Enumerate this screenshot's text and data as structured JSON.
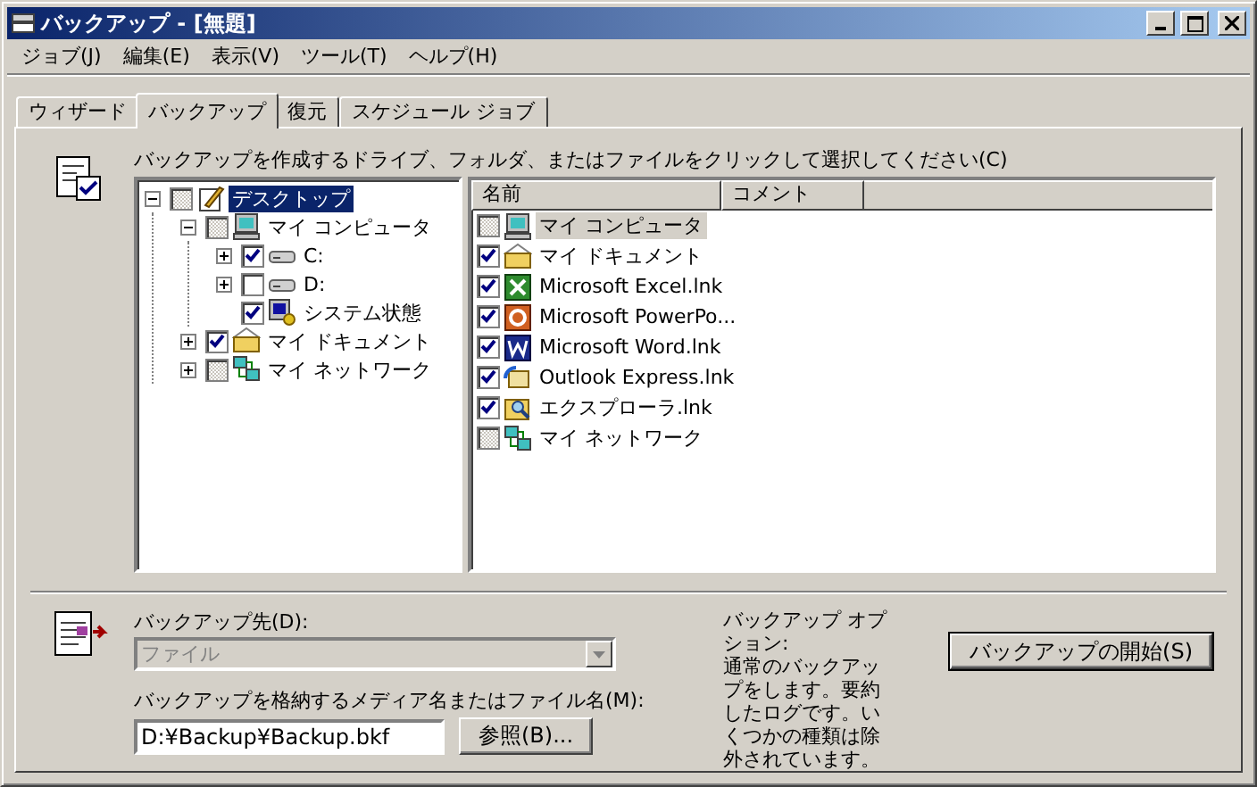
{
  "window": {
    "title": "バックアップ - [無題]"
  },
  "menu": [
    "ジョブ(J)",
    "編集(E)",
    "表示(V)",
    "ツール(T)",
    "ヘルプ(H)"
  ],
  "tabs": [
    {
      "label": "ウィザード",
      "selected": false
    },
    {
      "label": "バックアップ",
      "selected": true
    },
    {
      "label": "復元",
      "selected": false
    },
    {
      "label": "スケジュール ジョブ",
      "selected": false
    }
  ],
  "instruction": "バックアップを作成するドライブ、フォルダ、またはファイルをクリックして選択してください(C)",
  "tree": [
    {
      "label": "デスクトップ",
      "kind": "desktop",
      "checked": false,
      "partial": true,
      "expanded": true,
      "selected": true,
      "children": [
        {
          "label": "マイ コンピュータ",
          "kind": "computer",
          "checked": false,
          "partial": true,
          "expanded": true,
          "selected": false,
          "children": [
            {
              "label": "C:",
              "kind": "drive",
              "checked": true,
              "expanded": false,
              "selected": false
            },
            {
              "label": "D:",
              "kind": "drive",
              "checked": false,
              "partial": false,
              "expanded": false,
              "selected": false
            },
            {
              "label": "システム状態",
              "kind": "system",
              "checked": true,
              "selected": false
            }
          ]
        },
        {
          "label": "マイ ドキュメント",
          "kind": "folder",
          "checked": true,
          "expanded": false,
          "selected": false
        },
        {
          "label": "マイ ネットワーク",
          "kind": "network",
          "checked": false,
          "partial": true,
          "expanded": false,
          "selected": false
        }
      ]
    }
  ],
  "list": {
    "columns": [
      "名前",
      "コメント"
    ],
    "rows": [
      {
        "name": "マイ コンピュータ",
        "kind": "computer",
        "checked": false,
        "partial": true,
        "selected": true
      },
      {
        "name": "マイ ドキュメント",
        "kind": "folder",
        "checked": true,
        "selected": false
      },
      {
        "name": "Microsoft Excel.lnk",
        "kind": "excel",
        "checked": true,
        "selected": false
      },
      {
        "name": "Microsoft PowerPo...",
        "kind": "powerpoint",
        "checked": true,
        "selected": false
      },
      {
        "name": "Microsoft Word.lnk",
        "kind": "word",
        "checked": true,
        "selected": false
      },
      {
        "name": "Outlook Express.lnk",
        "kind": "outlook",
        "checked": true,
        "selected": false
      },
      {
        "name": "エクスプローラ.lnk",
        "kind": "explorer",
        "checked": true,
        "selected": false
      },
      {
        "name": "マイ ネットワーク",
        "kind": "network",
        "checked": false,
        "partial": true,
        "selected": false
      }
    ]
  },
  "destination": {
    "label": "バックアップ先(D):",
    "value": "ファイル",
    "disabled": true
  },
  "media": {
    "label": "バックアップを格納するメディア名またはファイル名(M):",
    "value": "D:¥Backup¥Backup.bkf",
    "browse": "参照(B)..."
  },
  "options": {
    "title": "バックアップ オプション:",
    "text": "通常のバックアップをします。要約したログです。いくつかの種類は除外されています。"
  },
  "start_button": "バックアップの開始(S)"
}
